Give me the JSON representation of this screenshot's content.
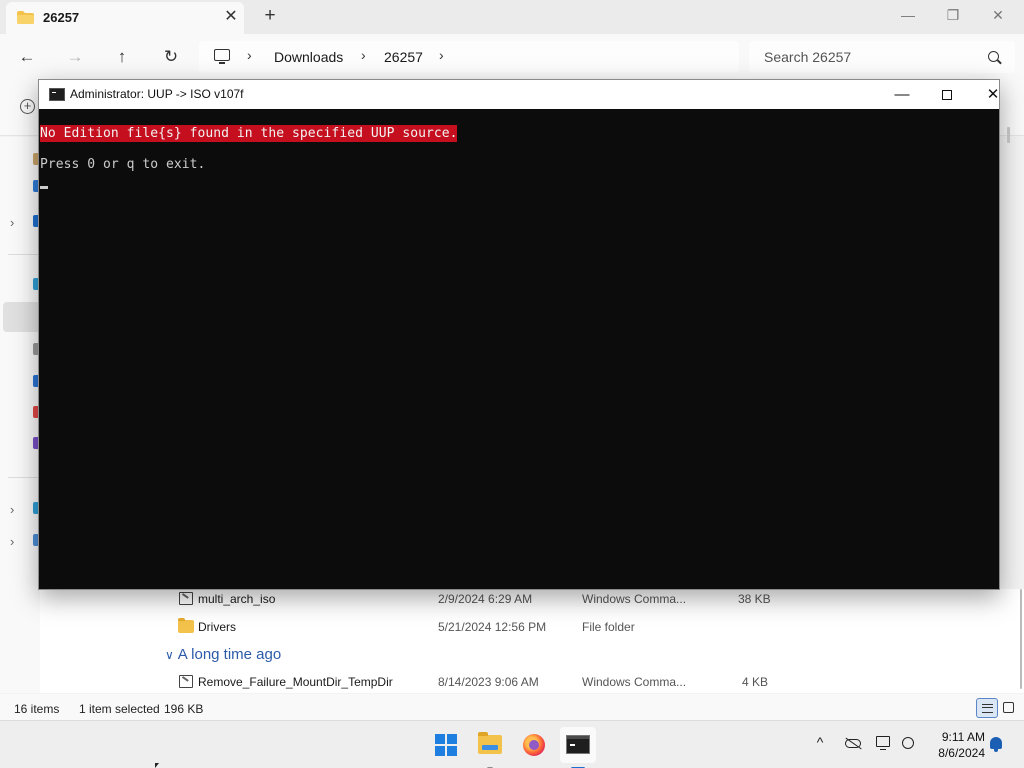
{
  "explorer": {
    "tab_title": "26257",
    "new_tab": "+",
    "close_tab": "✕",
    "window_controls": {
      "minimize": "—",
      "maximize": "❐",
      "close": "✕"
    },
    "nav": {
      "back": "←",
      "forward": "→",
      "up": "↑",
      "refresh": "↻"
    },
    "breadcrumb": {
      "items": [
        "Downloads",
        "26257"
      ],
      "separator": "›"
    },
    "search": {
      "placeholder": "Search 26257"
    },
    "files": [
      {
        "name": "multi_arch_iso",
        "date": "2/9/2024 6:29 AM",
        "type": "Windows Comma...",
        "size": "38 KB",
        "icon": "cmd-file-icon"
      },
      {
        "name": "Drivers",
        "date": "5/21/2024 12:56 PM",
        "type": "File folder",
        "size": "",
        "icon": "folder-icon"
      }
    ],
    "group_header": "A long time ago",
    "group_files": [
      {
        "name": "Remove_Failure_MountDir_TempDir",
        "date": "8/14/2023 9:06 AM",
        "type": "Windows Comma...",
        "size": "4 KB",
        "icon": "cmd-file-icon"
      }
    ],
    "status": {
      "items": "16 items",
      "selected": "1 item selected",
      "size": "196 KB"
    }
  },
  "cmd": {
    "title": "Administrator:  UUP -> ISO v107f",
    "controls": {
      "minimize": "—",
      "close": "✕"
    },
    "lines": {
      "error": "No Edition file{s} found in the specified UUP source.",
      "prompt": "Press 0 or q to exit."
    },
    "colors": {
      "background": "#0c0c0c",
      "text": "#cccccc",
      "error_bg": "#c50f1f"
    }
  },
  "taskbar": {
    "apps": [
      "start-icon",
      "file-explorer-icon",
      "firefox-icon",
      "terminal-icon"
    ],
    "tray_chevron": "^",
    "clock": {
      "time": "9:11 AM",
      "date": "8/6/2024"
    }
  }
}
